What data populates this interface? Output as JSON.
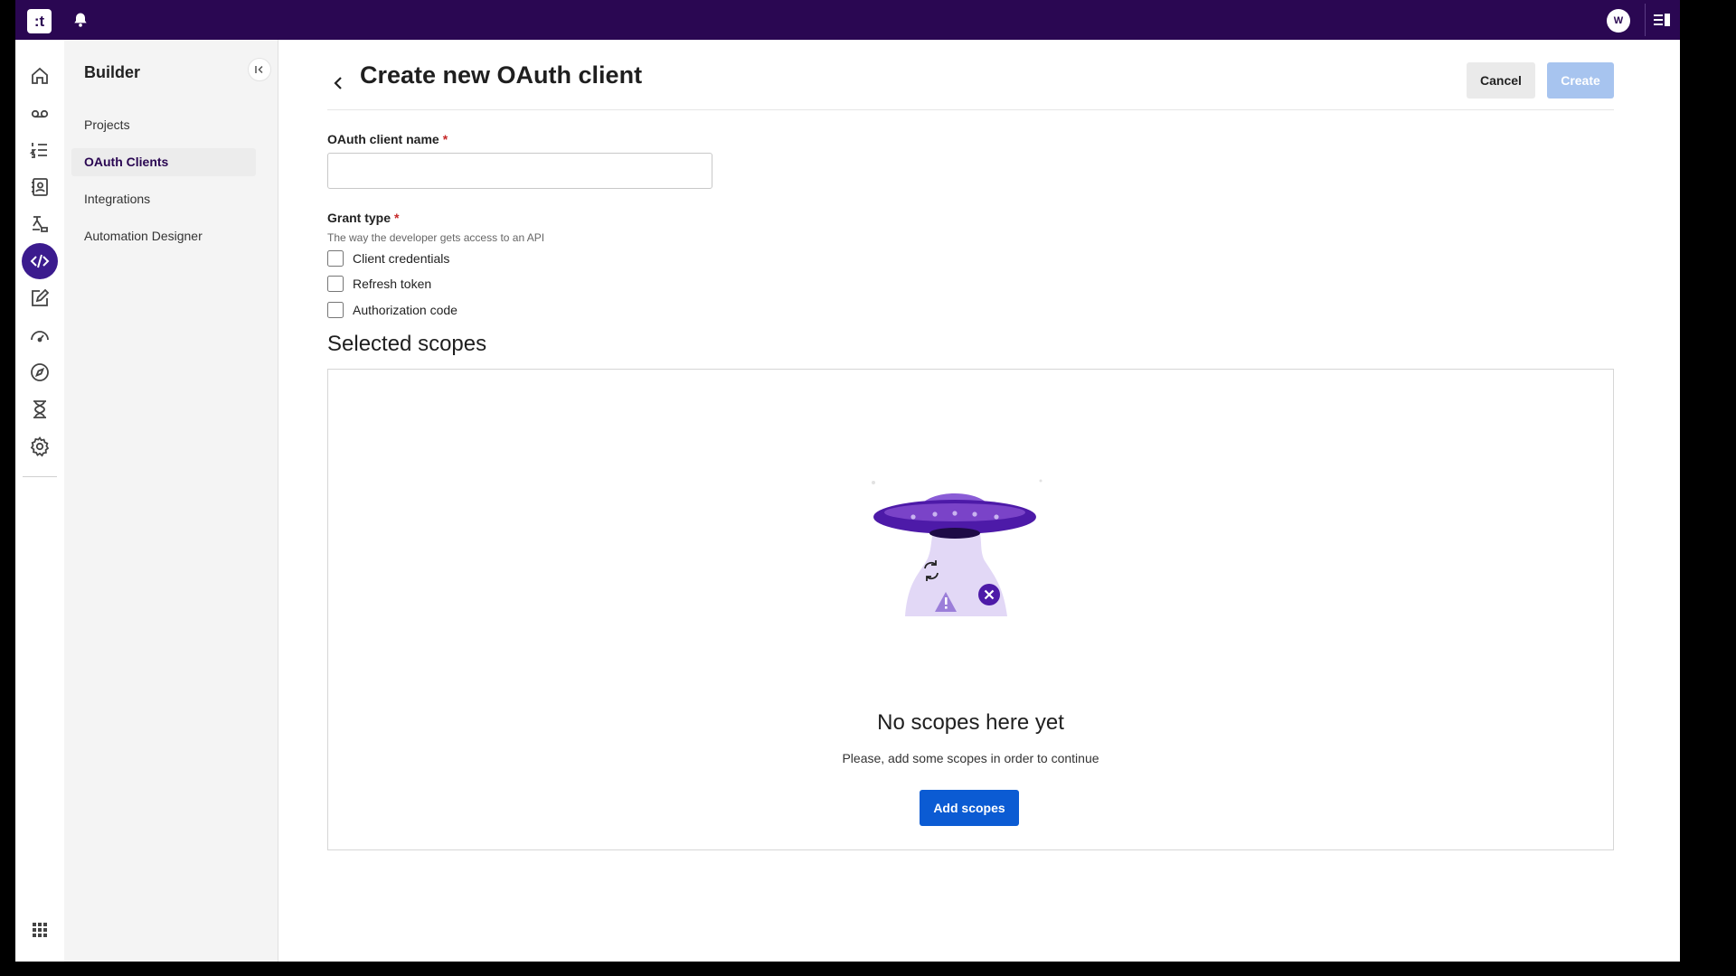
{
  "app": {
    "logo_text": ":t",
    "user_initial": "W",
    "colors": {
      "topbar": "#2a0752",
      "accent": "#3b1b8e",
      "primary_button": "#0b5bd3",
      "disabled_button": "#a7c4ef",
      "required": "#c62828"
    }
  },
  "topbar": {
    "icons": [
      "bell-icon",
      "panel-toggle-icon"
    ]
  },
  "rail": {
    "items": [
      {
        "icon": "home-icon"
      },
      {
        "icon": "voicemail-icon"
      },
      {
        "icon": "numbered-list-icon"
      },
      {
        "icon": "contacts-icon"
      },
      {
        "icon": "flow-icon"
      },
      {
        "icon": "code-icon",
        "active": true
      },
      {
        "icon": "edit-icon"
      },
      {
        "icon": "dashboard-icon"
      },
      {
        "icon": "compass-icon"
      },
      {
        "icon": "hourglass-icon"
      },
      {
        "icon": "gear-icon"
      },
      {
        "icon": "apps-grid-icon"
      }
    ]
  },
  "sidebar": {
    "title": "Builder",
    "items": [
      {
        "label": "Projects"
      },
      {
        "label": "OAuth Clients",
        "active": true
      },
      {
        "label": "Integrations"
      },
      {
        "label": "Automation Designer"
      }
    ]
  },
  "header": {
    "title": "Create new OAuth client",
    "cancel_label": "Cancel",
    "create_label": "Create"
  },
  "form": {
    "name_label": "OAuth client name",
    "name_value": "",
    "required_mark": "*",
    "grant_label": "Grant type",
    "grant_helper": "The way the developer gets access to an API",
    "grant_options": [
      {
        "label": "Client credentials",
        "checked": false
      },
      {
        "label": "Refresh token",
        "checked": false
      },
      {
        "label": "Authorization code",
        "checked": false
      }
    ]
  },
  "scopes": {
    "title": "Selected scopes",
    "empty_title": "No scopes here yet",
    "empty_subtitle": "Please, add some scopes in order to continue",
    "add_label": "Add scopes"
  }
}
